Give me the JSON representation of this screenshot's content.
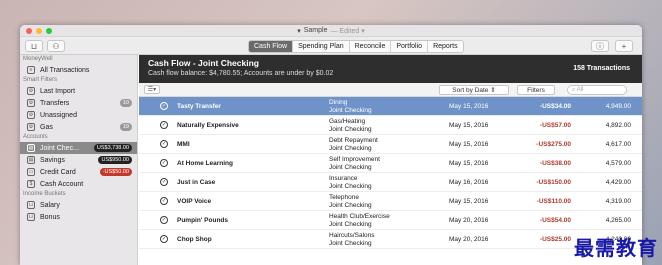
{
  "window": {
    "title": "Sample",
    "edited": "— Edited ▾"
  },
  "toolbar": {
    "tabs": [
      "Cash Flow",
      "Spending Plan",
      "Reconcile",
      "Portfolio",
      "Reports"
    ],
    "active_tab": "Cash Flow"
  },
  "sidebar": {
    "moneywell_head": "MoneyWell",
    "all_transactions": "All Transactions",
    "smart_filters_head": "Smart Filters",
    "filters": [
      {
        "label": "Last Import",
        "badge": ""
      },
      {
        "label": "Transfers",
        "badge": "10"
      },
      {
        "label": "Unassigned",
        "badge": ""
      },
      {
        "label": "Gas",
        "badge": "19"
      }
    ],
    "accounts_head": "Accounts",
    "accounts": [
      {
        "label": "Joint Chec...",
        "badge": "US$3,738.00"
      },
      {
        "label": "Savings",
        "badge": "US$950.00"
      },
      {
        "label": "Credit Card",
        "badge": "-US$50.00"
      },
      {
        "label": "Cash Account",
        "badge": ""
      }
    ],
    "buckets_head": "Income Buckets",
    "buckets": [
      {
        "label": "Salary"
      },
      {
        "label": "Bonus"
      }
    ]
  },
  "header": {
    "title": "Cash Flow - Joint Checking",
    "subtitle": "Cash flow balance: $4,780.55; Accounts are under by $0.02",
    "count": "158 Transactions"
  },
  "filterbar": {
    "sort": "Sort by Date",
    "filters": "Filters",
    "search_placeholder": "All"
  },
  "transactions": [
    {
      "payee": "Tasty Transfer",
      "cat1": "Dining",
      "cat2": "Joint Checking",
      "date": "May 15, 2016",
      "amount": "-US$34.00",
      "balance": "4,949.00"
    },
    {
      "payee": "Naturally Expensive",
      "cat1": "Gas/Heating",
      "cat2": "Joint Checking",
      "date": "May 15, 2016",
      "amount": "-US$57.00",
      "balance": "4,892.00"
    },
    {
      "payee": "MMI",
      "cat1": "Debt Repayment",
      "cat2": "Joint Checking",
      "date": "May 15, 2016",
      "amount": "-US$275.00",
      "balance": "4,617.00"
    },
    {
      "payee": "At Home Learning",
      "cat1": "Self Improvement",
      "cat2": "Joint Checking",
      "date": "May 15, 2016",
      "amount": "-US$38.00",
      "balance": "4,579.00"
    },
    {
      "payee": "Just in Case",
      "cat1": "Insurance",
      "cat2": "Joint Checking",
      "date": "May 16, 2016",
      "amount": "-US$150.00",
      "balance": "4,429.00"
    },
    {
      "payee": "VOIP Voice",
      "cat1": "Telephone",
      "cat2": "Joint Checking",
      "date": "May 15, 2016",
      "amount": "-US$110.00",
      "balance": "4,319.00"
    },
    {
      "payee": "Pumpin' Pounds",
      "cat1": "Health Club/Exercise",
      "cat2": "Joint Checking",
      "date": "May 20, 2016",
      "amount": "-US$54.00",
      "balance": "4,265.00"
    },
    {
      "payee": "Chop Shop",
      "cat1": "Haircuts/Salons",
      "cat2": "Joint Checking",
      "date": "May 20, 2016",
      "amount": "-US$25.00",
      "balance": "4,240.00"
    }
  ],
  "watermark": "最需教育",
  "colors": {
    "selected_row": "#6f93c8",
    "header_bg": "#2e2e2e",
    "negative_amount": "#b03a2e",
    "active_tab": "#6a6a6a"
  }
}
